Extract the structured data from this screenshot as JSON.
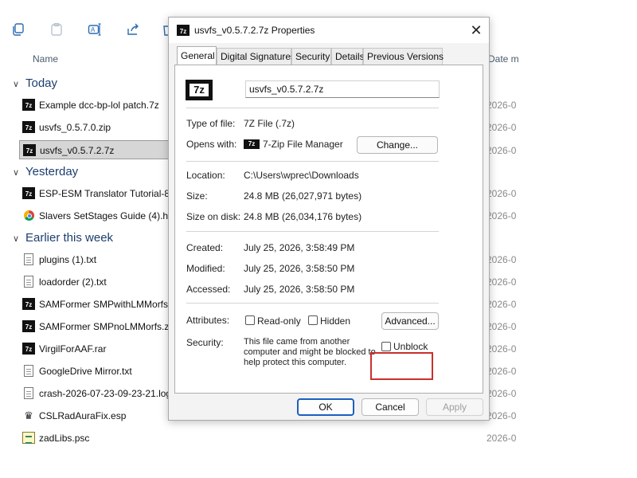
{
  "explorer": {
    "toolbar": {
      "icons": [
        "copy-icon",
        "paste-icon",
        "rename-icon",
        "share-icon",
        "delete-icon"
      ]
    },
    "columns": {
      "name": "Name",
      "date": "Date m"
    },
    "groups": [
      {
        "label": "Today"
      },
      {
        "label": "Yesterday"
      },
      {
        "label": "Earlier this week"
      }
    ],
    "files": [
      {
        "name": "Example dcc-bp-lol patch.7z",
        "date": "2026-0",
        "icon": "7z-icon"
      },
      {
        "name": "usvfs_0.5.7.0.zip",
        "date": "2026-0",
        "icon": "7z-icon"
      },
      {
        "name": "usvfs_v0.5.7.2.7z",
        "date": "2026-0",
        "icon": "7z-icon",
        "selected": true
      },
      {
        "name": "ESP-ESM Translator Tutorial-88",
        "date": "2026-0",
        "icon": "7z-icon"
      },
      {
        "name": "Slavers SetStages Guide  (4).htm",
        "date": "2026-0",
        "icon": "chrome-icon"
      },
      {
        "name": "plugins (1).txt",
        "date": "2026-0",
        "icon": "text-file-icon"
      },
      {
        "name": "loadorder (2).txt",
        "date": "2026-0",
        "icon": "text-file-icon"
      },
      {
        "name": "SAMFormer SMPwithLMMorfs.",
        "date": "2026-0",
        "icon": "7z-icon"
      },
      {
        "name": "SAMFormer SMPnoLMMorfs.zi",
        "date": "2026-0",
        "icon": "7z-icon"
      },
      {
        "name": "VirgilForAAF.rar",
        "date": "2026-0",
        "icon": "7z-icon"
      },
      {
        "name": "GoogleDrive Mirror.txt",
        "date": "2026-0",
        "icon": "text-file-icon"
      },
      {
        "name": "crash-2026-07-23-09-23-21.log",
        "date": "2026-0",
        "icon": "text-file-icon"
      },
      {
        "name": "CSLRadAuraFix.esp",
        "date": "2026-0",
        "icon": "esp-icon"
      },
      {
        "name": "zadLibs.psc",
        "date": "2026-0",
        "icon": "script-file-icon"
      }
    ]
  },
  "dialog": {
    "title": "usvfs_v0.5.7.2.7z Properties",
    "icon_text": "7z",
    "tabs": [
      "General",
      "Digital Signatures",
      "Security",
      "Details",
      "Previous Versions"
    ],
    "file_name": "usvfs_v0.5.7.2.7z",
    "type_label": "Type of file:",
    "type_value": "7Z File (.7z)",
    "opens_label": "Opens with:",
    "opens_value": "7-Zip File Manager",
    "change_button": "Change...",
    "location_label": "Location:",
    "location_value": "C:\\Users\\wprec\\Downloads",
    "size_label": "Size:",
    "size_value": "24.8 MB (26,027,971 bytes)",
    "size_disk_label": "Size on disk:",
    "size_disk_value": "24.8 MB (26,034,176 bytes)",
    "created_label": "Created:",
    "created_value": "July 25, 2026, 3:58:49 PM",
    "modified_label": "Modified:",
    "modified_value": "July 25, 2026, 3:58:50 PM",
    "accessed_label": "Accessed:",
    "accessed_value": "July 25, 2026, 3:58:50 PM",
    "attributes_label": "Attributes:",
    "readonly_label": "Read-only",
    "hidden_label": "Hidden",
    "advanced_button": "Advanced...",
    "security_label": "Security:",
    "security_text": "This file came from another computer and might be blocked to help protect this computer.",
    "unblock_label": "Unblock",
    "ok_button": "OK",
    "cancel_button": "Cancel",
    "apply_button": "Apply",
    "highlight_color": "#c9302c"
  }
}
